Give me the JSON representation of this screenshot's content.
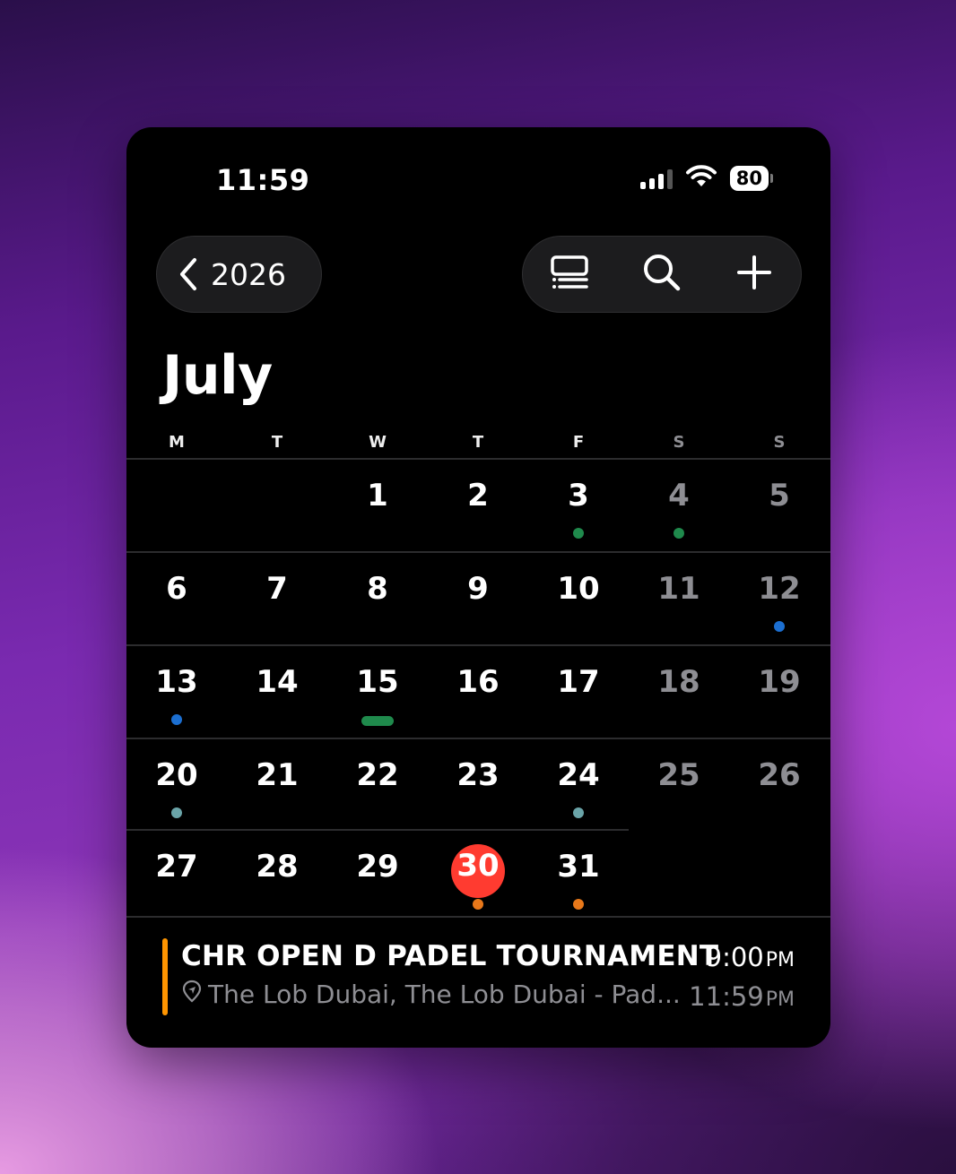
{
  "status_bar": {
    "time": "11:59",
    "battery": "80"
  },
  "nav": {
    "back_label": "2026"
  },
  "month_title": "July",
  "weekdays": [
    "M",
    "T",
    "W",
    "T",
    "F",
    "S",
    "S"
  ],
  "colors": {
    "today": "#ff3b30",
    "event_orange": "#e8781a",
    "event_green": "#1f8a4c",
    "event_blue": "#1c6fd1",
    "event_teal": "#6aa4a8"
  },
  "weeks": [
    [
      null,
      null,
      {
        "day": "1"
      },
      {
        "day": "2"
      },
      {
        "day": "3",
        "dot": "event_green"
      },
      {
        "day": "4",
        "weekend": true,
        "dot": "event_green"
      },
      {
        "day": "5",
        "weekend": true
      }
    ],
    [
      {
        "day": "6"
      },
      {
        "day": "7"
      },
      {
        "day": "8"
      },
      {
        "day": "9"
      },
      {
        "day": "10"
      },
      {
        "day": "11",
        "weekend": true
      },
      {
        "day": "12",
        "weekend": true,
        "dot": "event_blue"
      }
    ],
    [
      {
        "day": "13",
        "dot": "event_blue"
      },
      {
        "day": "14"
      },
      {
        "day": "15",
        "bar": "event_green"
      },
      {
        "day": "16"
      },
      {
        "day": "17"
      },
      {
        "day": "18",
        "weekend": true
      },
      {
        "day": "19",
        "weekend": true
      }
    ],
    [
      {
        "day": "20",
        "dot": "event_teal"
      },
      {
        "day": "21"
      },
      {
        "day": "22"
      },
      {
        "day": "23"
      },
      {
        "day": "24",
        "dot": "event_teal"
      },
      {
        "day": "25",
        "weekend": true
      },
      {
        "day": "26",
        "weekend": true
      }
    ],
    [
      {
        "day": "27"
      },
      {
        "day": "28"
      },
      {
        "day": "29"
      },
      {
        "day": "30",
        "today": true,
        "dot": "event_orange"
      },
      {
        "day": "31",
        "dot": "event_orange"
      },
      null,
      null
    ]
  ],
  "event": {
    "title": "CHR OPEN D PADEL TOURNAMENT",
    "start_time": "9:00",
    "start_ampm": "PM",
    "location": "The Lob Dubai, The Lob Dubai - Pad...",
    "end_time": "11:59",
    "end_ampm": "PM"
  }
}
